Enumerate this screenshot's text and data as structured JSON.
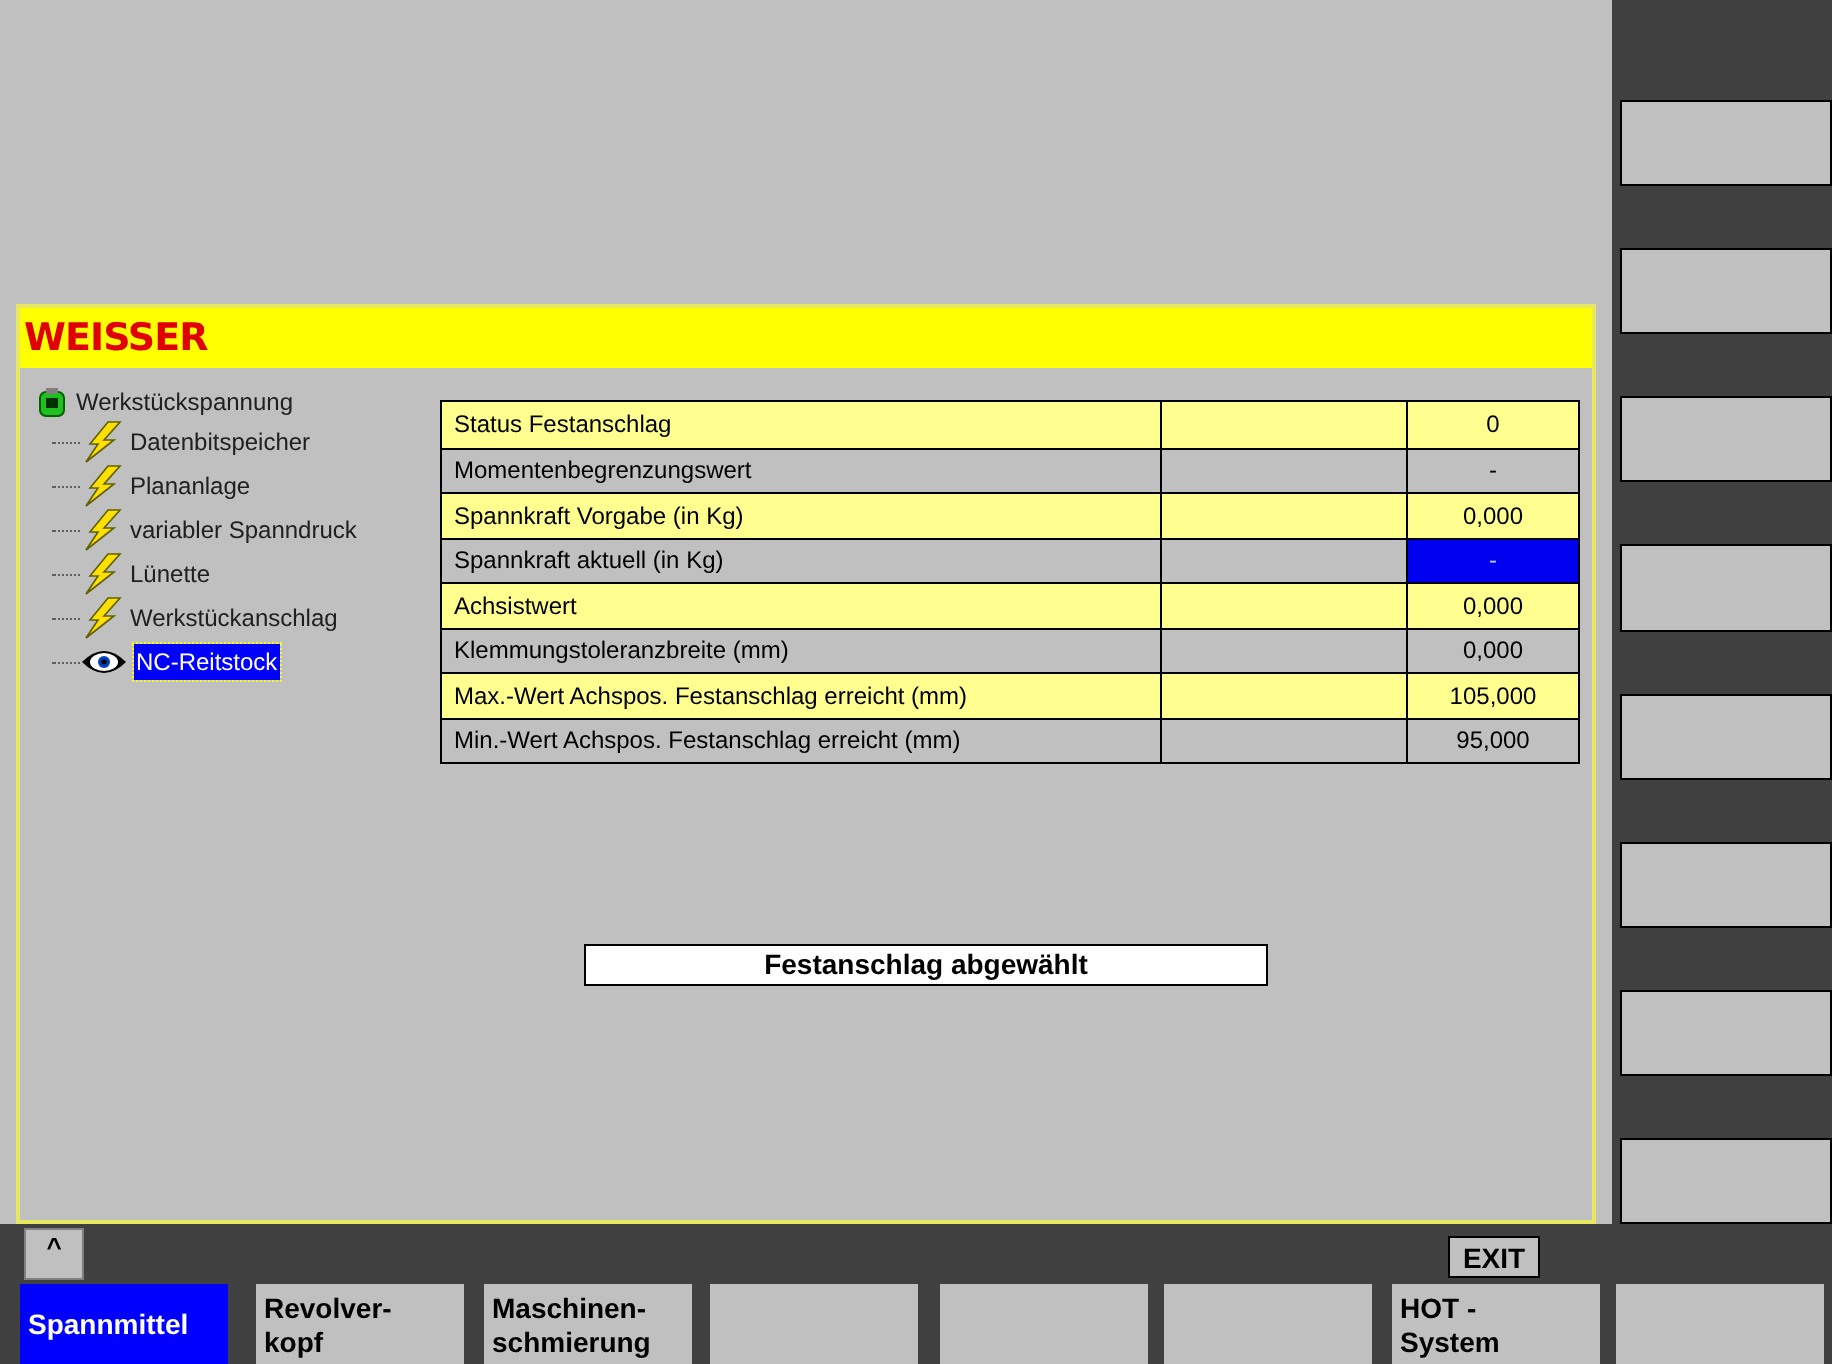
{
  "panel": {
    "title": "WEISSER"
  },
  "tree": {
    "label": "Werkstückspannung",
    "children": [
      {
        "label": "Datenbitspeicher",
        "kind": "flash",
        "selected": false
      },
      {
        "label": "Plananlage",
        "kind": "flash",
        "selected": false
      },
      {
        "label": "variabler Spanndruck",
        "kind": "flash",
        "selected": false
      },
      {
        "label": "Lünette",
        "kind": "flash",
        "selected": false
      },
      {
        "label": "Werkstückanschlag",
        "kind": "flash",
        "selected": false
      },
      {
        "label": "NC-Reitstock",
        "kind": "eye",
        "selected": true
      }
    ]
  },
  "table": {
    "rows": [
      {
        "name": "Status Festanschlag",
        "value": "0",
        "selected": false
      },
      {
        "name": "Momentenbegrenzungswert",
        "value": "-",
        "selected": false
      },
      {
        "name": "Spannkraft Vorgabe (in Kg)",
        "value": "0,000",
        "selected": false
      },
      {
        "name": "Spannkraft aktuell (in Kg)",
        "value": "-",
        "selected": true
      },
      {
        "name": "Achsistwert",
        "value": "0,000",
        "selected": false
      },
      {
        "name": "Klemmungstoleranzbreite (mm)",
        "value": "0,000",
        "selected": false
      },
      {
        "name": "Max.-Wert Achspos. Festanschlag erreicht (mm)",
        "value": "105,000",
        "selected": false
      },
      {
        "name": "Min.-Wert Achspos. Festanschlag erreicht (mm)",
        "value": "95,000",
        "selected": false
      }
    ]
  },
  "message": "Festanschlag abgewählt",
  "recall_key": "^",
  "exit_key": "EXIT",
  "softkeys": [
    {
      "lines": [
        "Spannmittel"
      ],
      "selected": true
    },
    {
      "lines": [
        "Revolver-",
        "kopf"
      ],
      "selected": false
    },
    {
      "lines": [
        "Maschinen-",
        "schmierung"
      ],
      "selected": false
    },
    {
      "selected": false
    },
    {
      "selected": false
    },
    {
      "selected": false
    },
    {
      "lines": [
        "HOT -",
        "System"
      ],
      "selected": false
    },
    {
      "selected": false
    }
  ]
}
